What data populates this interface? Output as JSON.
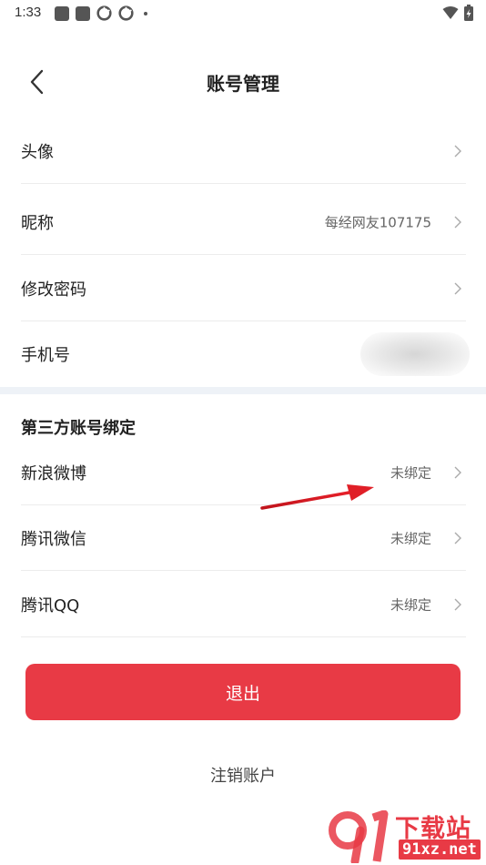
{
  "status_bar": {
    "time": "1:33"
  },
  "header": {
    "title": "账号管理"
  },
  "account_rows": [
    {
      "label": "头像",
      "value": ""
    },
    {
      "label": "昵称",
      "value": "每经网友107175"
    },
    {
      "label": "修改密码",
      "value": ""
    },
    {
      "label": "手机号",
      "value": ""
    }
  ],
  "third_party": {
    "section_title": "第三方账号绑定",
    "rows": [
      {
        "label": "新浪微博",
        "value": "未绑定"
      },
      {
        "label": "腾讯微信",
        "value": "未绑定"
      },
      {
        "label": "腾讯QQ",
        "value": "未绑定"
      }
    ]
  },
  "actions": {
    "logout_label": "退出",
    "cancel_account_label": "注销账户"
  },
  "watermark": {
    "title": "下载站",
    "site": "91xz.net"
  },
  "colors": {
    "accent": "#e83a45",
    "section_bg": "#eef2f7",
    "divider": "#ececec"
  },
  "icons": {
    "back": "chevron-left-icon",
    "row_arrow": "chevron-right-icon"
  }
}
